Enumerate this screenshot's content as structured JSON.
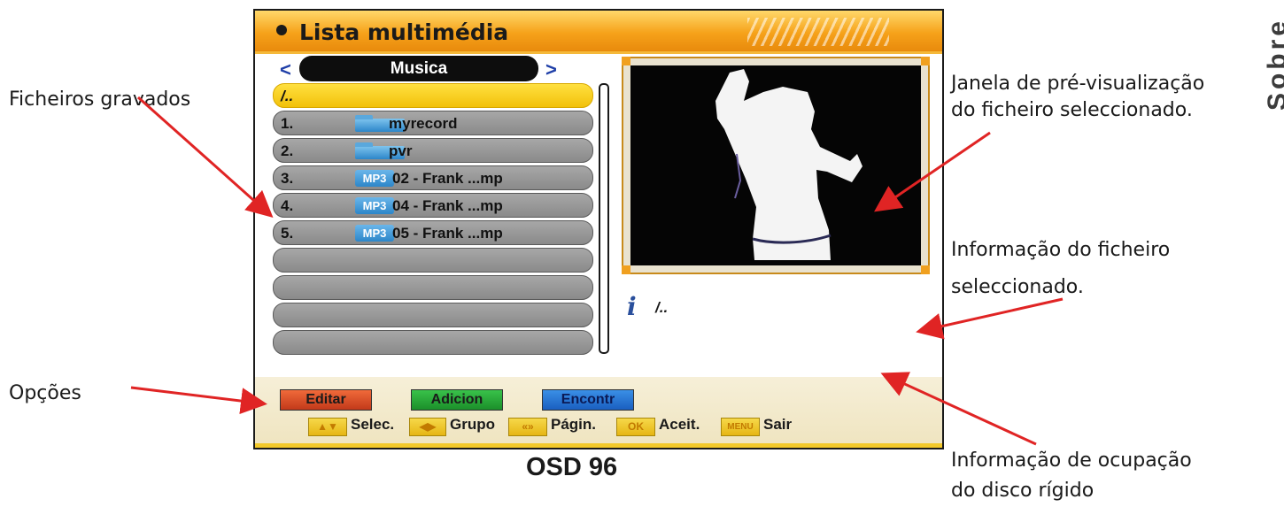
{
  "osd": {
    "title": "Lista multimédia",
    "category": "Musica",
    "files": [
      {
        "num": "",
        "name": "/..",
        "type": "parent",
        "selected": true
      },
      {
        "num": "1.",
        "name": "myrecord",
        "type": "folder",
        "selected": false
      },
      {
        "num": "2.",
        "name": "pvr",
        "type": "folder",
        "selected": false
      },
      {
        "num": "3.",
        "name": "02 - Frank ...mp",
        "type": "mp3",
        "selected": false
      },
      {
        "num": "4.",
        "name": "04 - Frank ...mp",
        "type": "mp3",
        "selected": false
      },
      {
        "num": "5.",
        "name": "05 - Frank ...mp",
        "type": "mp3",
        "selected": false
      },
      {
        "num": "",
        "name": "",
        "type": "empty",
        "selected": false
      },
      {
        "num": "",
        "name": "",
        "type": "empty",
        "selected": false
      },
      {
        "num": "",
        "name": "",
        "type": "empty",
        "selected": false
      },
      {
        "num": "",
        "name": "",
        "type": "empty",
        "selected": false
      }
    ],
    "mp3_badge": "MP3",
    "info_text": "/..",
    "options": {
      "edit": "Editar",
      "add": "Adicion",
      "find": "Encontr"
    },
    "keys": [
      {
        "key": "▲▼",
        "label": "Selec."
      },
      {
        "key": "◀▶",
        "label": "Grupo"
      },
      {
        "key": "«»",
        "label": "Págin."
      },
      {
        "key": "OK",
        "label": "Aceit."
      },
      {
        "key": "MENU",
        "label": "Sair"
      }
    ]
  },
  "annotations": {
    "recorded_files": "Ficheiros gravados",
    "options": "Opções",
    "preview_line1": "Janela de pré-visualização",
    "preview_line2": "do ficheiro seleccionado.",
    "info_line1": "Informação do ficheiro",
    "info_line2": "seleccionado.",
    "disk_line1": "Informação de ocupação",
    "disk_line2": "do disco rígido"
  },
  "caption": "OSD 96",
  "side_tab_text": "Sobre"
}
